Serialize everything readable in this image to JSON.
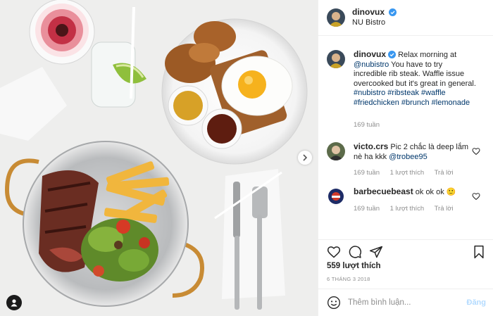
{
  "post": {
    "author": "dinovux",
    "location": "NU Bistro"
  },
  "caption": {
    "username": "dinovux",
    "text_prefix": "Relax morning at",
    "mention": "@nubistro",
    "text_body": "You have to try incredible rib steak. Waffle issue overcooked but it's great in general.",
    "hashtags": "#nubistro #ribsteak #waffle #friedchicken #brunch #lemonade",
    "time": "169 tuần"
  },
  "comments": [
    {
      "username": "victo.crs",
      "text": "Pic 2 chắc là deep lắm nè ha kkk",
      "mention": "@trobee95",
      "time": "169 tuần",
      "likes": "1 lượt thích",
      "reply": "Trả lời"
    },
    {
      "username": "barbecuebeast",
      "text": "ok ok ok",
      "emoji": "🙂",
      "time": "169 tuần",
      "likes": "1 lượt thích",
      "reply": "Trả lời"
    }
  ],
  "stats": {
    "likes_label": "559 lượt thích",
    "date": "6 THÁNG 3 2018"
  },
  "composer": {
    "placeholder": "Thêm bình luận...",
    "post_label": "Đăng"
  },
  "icons": {
    "verified": "verified-badge-icon",
    "like": "heart-icon",
    "comment": "comment-icon",
    "share": "share-icon",
    "save": "bookmark-icon",
    "emoji": "smiley-icon",
    "next": "chevron-right-icon",
    "tags": "user-tag-icon"
  },
  "colors": {
    "link": "#00376b",
    "verified": "#3897f0",
    "muted": "#8e8e8e",
    "post_disabled": "#b3dbff"
  }
}
